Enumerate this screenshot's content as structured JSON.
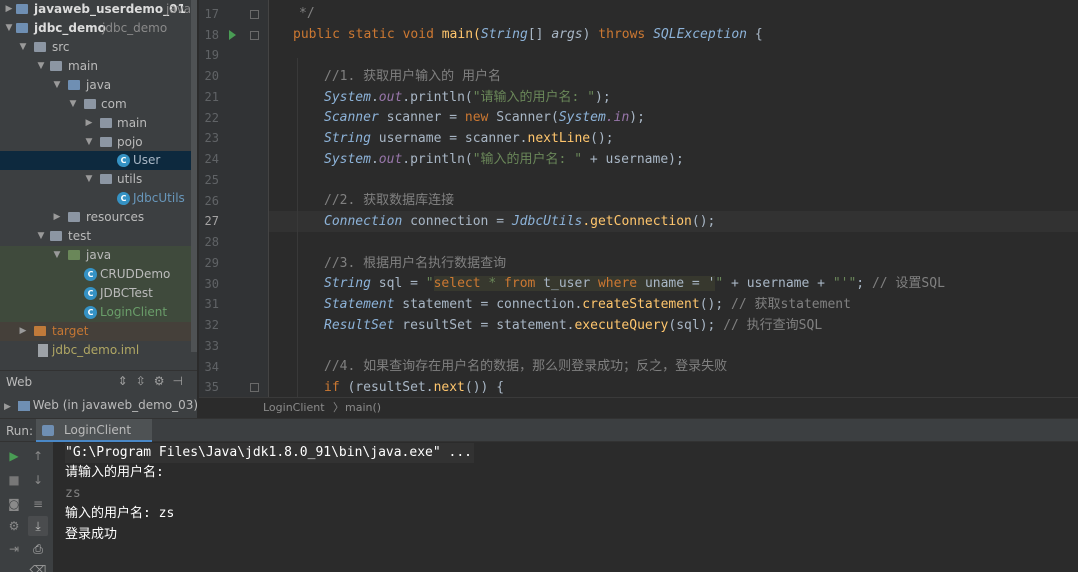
{
  "project_tree": {
    "rows": [
      {
        "label": "javaweb_userdemo_01",
        "suffix": "javawe",
        "depth": 0,
        "expanded": false,
        "icon": "module-folder-icon"
      },
      {
        "label": "jdbc_demo",
        "suffix": "jdbc_demo",
        "depth": 0,
        "expanded": true,
        "icon": "module-folder-icon"
      },
      {
        "label": "src",
        "depth": 1,
        "expanded": true,
        "icon": "folder-icon"
      },
      {
        "label": "main",
        "depth": 2,
        "expanded": true,
        "icon": "folder-icon"
      },
      {
        "label": "java",
        "depth": 3,
        "expanded": true,
        "icon": "source-folder-icon"
      },
      {
        "label": "com",
        "depth": 4,
        "expanded": true,
        "icon": "package-icon"
      },
      {
        "label": "main",
        "depth": 5,
        "expanded": false,
        "icon": "package-icon"
      },
      {
        "label": "pojo",
        "depth": 5,
        "expanded": true,
        "icon": "package-icon"
      },
      {
        "label": "User",
        "depth": 6,
        "icon": "class-icon",
        "selected": true
      },
      {
        "label": "utils",
        "depth": 5,
        "expanded": true,
        "icon": "package-icon"
      },
      {
        "label": "JdbcUtils",
        "depth": 6,
        "icon": "class-icon"
      },
      {
        "label": "resources",
        "depth": 3,
        "expanded": false,
        "icon": "resources-folder-icon"
      },
      {
        "label": "test",
        "depth": 2,
        "expanded": true,
        "icon": "folder-icon"
      },
      {
        "label": "java",
        "depth": 3,
        "expanded": true,
        "icon": "test-source-folder-icon"
      },
      {
        "label": "CRUDDemo",
        "depth": 4,
        "icon": "class-icon"
      },
      {
        "label": "JDBCTest",
        "depth": 4,
        "icon": "class-icon"
      },
      {
        "label": "LoginClient",
        "depth": 4,
        "icon": "class-icon"
      },
      {
        "label": "target",
        "depth": 1,
        "expanded": false,
        "icon": "excluded-folder-icon"
      },
      {
        "label": "jdbc_demo.iml",
        "depth": 1,
        "icon": "iml-file-icon"
      }
    ]
  },
  "web_panel": {
    "title": "Web",
    "item": "Web (in javaweb_demo_03)"
  },
  "editor": {
    "line_numbers": [
      "17",
      "18",
      "19",
      "20",
      "21",
      "22",
      "23",
      "24",
      "25",
      "26",
      "27",
      "28",
      "29",
      "30",
      "31",
      "32",
      "33",
      "34",
      "35"
    ],
    "current_line": "27",
    "breadcrumb": [
      "LoginClient",
      "main()"
    ],
    "lines": {
      "l17": "*/",
      "l18_public": "public",
      "l18_static": "static",
      "l18_void": "void",
      "l18_main": "main(",
      "l18_String": "String",
      "l18_args_open": "[] ",
      "l18_args": "args",
      "l18_close": ") ",
      "l18_throws": "throws",
      "l18_exc": "SQLException",
      "l18_brace": " {",
      "l20": "//1. 获取用户输入的 用户名",
      "l21_sys": "System",
      "l21_dot": ".",
      "l21_out": "out",
      "l21_println": ".println(",
      "l21_str": "\"请输入的用户名: \"",
      "l21_end": ");",
      "l22_type": "Scanner",
      "l22_var": " scanner = ",
      "l22_new": "new",
      "l22_ctor": " Scanner(",
      "l22_sys": "System",
      "l22_in": ".in",
      "l22_end": ");",
      "l23_type": "String",
      "l23_rest": " username = scanner.",
      "l23_m": "nextLine",
      "l23_end": "();",
      "l24_sys": "System",
      "l24_out": "out",
      "l24_println": ".println(",
      "l24_str": "\"输入的用户名: \"",
      "l24_rest": " + username);",
      "l26": "//2. 获取数据库连接",
      "l27_type": "Connection",
      "l27_rest": " connection = ",
      "l27_cls": "JdbcUtils",
      "l27_m": ".getConnection",
      "l27_end": "();",
      "l29": "//3. 根据用户名执行数据查询",
      "l30_type": "String",
      "l30_var": " sql = ",
      "l30_q1": "\"",
      "l30_select": "select",
      "l30_star": " * ",
      "l30_from": "from",
      "l30_tbl": " t_user ",
      "l30_where": "where",
      "l30_cond": " uname = '",
      "l30_q2": "\"",
      "l30_plus": " + username + ",
      "l30_q3": "\"'\"",
      "l30_end": "; ",
      "l30_cmt": "// 设置SQL",
      "l31_type": "Statement",
      "l31_rest": " statement = connection.",
      "l31_m": "createStatement",
      "l31_end": "(); ",
      "l31_cmt": "// 获取statement",
      "l32_type": "ResultSet",
      "l32_rest": " resultSet = statement.",
      "l32_m": "executeQuery",
      "l32_end": "(sql); ",
      "l32_cmt": "// 执行查询SQL",
      "l34": "//4. 如果查询存在用户名的数据，那么则登录成功；反之，登录失败",
      "l35_if": "if",
      "l35_rest": " (resultSet.",
      "l35_m": "next",
      "l35_end": "()) {"
    }
  },
  "run_panel": {
    "label": "Run:",
    "tab": "LoginClient",
    "console": [
      "\"G:\\Program Files\\Java\\jdk1.8.0_91\\bin\\java.exe\" ...",
      "请输入的用户名:",
      "zs",
      "输入的用户名: zs",
      "登录成功"
    ]
  }
}
